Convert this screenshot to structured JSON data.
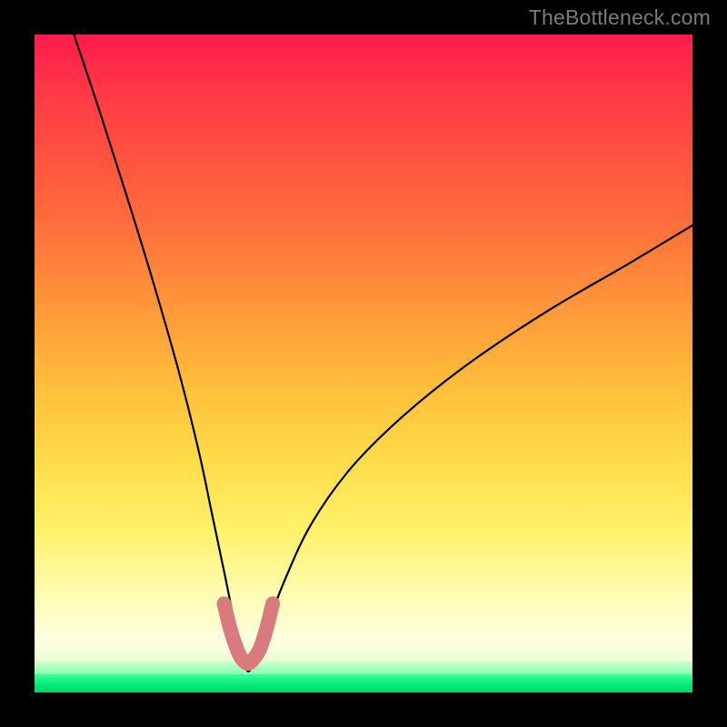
{
  "watermark": "TheBottleneck.com",
  "chart_data": {
    "type": "line",
    "title": "",
    "xlabel": "",
    "ylabel": "",
    "xlim": [
      0,
      100
    ],
    "ylim": [
      0,
      100
    ],
    "grid": false,
    "legend": false,
    "series": [
      {
        "name": "bottleneck-curve",
        "x": [
          6,
          10,
          14,
          18,
          22,
          25,
          27,
          29,
          30.5,
          31.5,
          32.5,
          33.5,
          35.5,
          38,
          42,
          48,
          56,
          66,
          78,
          90,
          100
        ],
        "y": [
          100,
          88,
          75.5,
          62.5,
          48.5,
          36.5,
          27,
          17.5,
          10,
          5.5,
          3.2,
          5.5,
          10.5,
          17,
          25.5,
          34,
          42,
          50,
          58,
          65,
          71
        ]
      },
      {
        "name": "min-band-marker",
        "x": [
          28.8,
          29.8,
          30.8,
          31.6,
          32.4,
          33.2,
          34.2,
          35.2,
          36.2
        ],
        "y": [
          13.5,
          9.5,
          6.5,
          5.0,
          4.4,
          5.0,
          6.5,
          9.5,
          13.5
        ]
      }
    ],
    "annotations": [
      {
        "text": "TheBottleneck.com",
        "role": "watermark",
        "position": "top-right"
      }
    ],
    "background": {
      "type": "vertical-gradient",
      "stops": [
        {
          "pct": 0,
          "color": "#ff1a4d"
        },
        {
          "pct": 30,
          "color": "#ff6a3c"
        },
        {
          "pct": 58,
          "color": "#ffbe3a"
        },
        {
          "pct": 82,
          "color": "#fff26a"
        },
        {
          "pct": 95,
          "color": "#e8ffd4"
        },
        {
          "pct": 100,
          "color": "#00d56a"
        }
      ]
    }
  }
}
